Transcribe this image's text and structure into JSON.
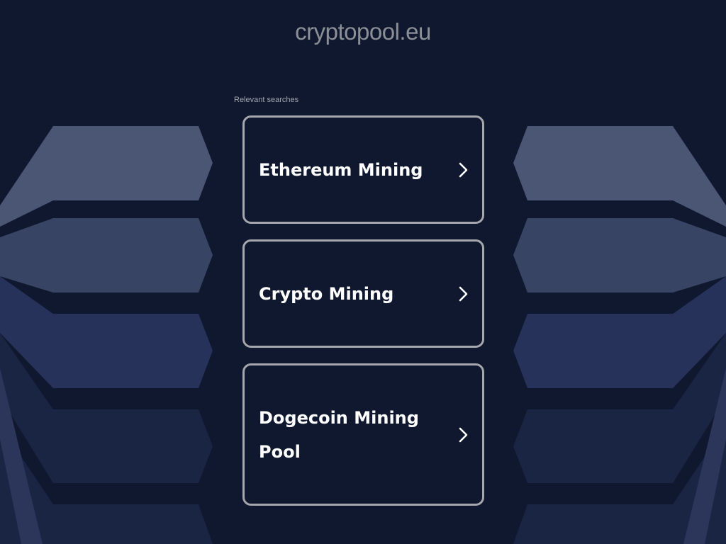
{
  "site": {
    "title": "cryptopool.eu"
  },
  "searches": {
    "heading": "Relevant searches",
    "items": [
      {
        "label": "Ethereum Mining",
        "icon": "chevron-right-icon"
      },
      {
        "label": "Crypto Mining",
        "icon": "chevron-right-icon"
      },
      {
        "label": "Dogecoin Mining Pool",
        "icon": "chevron-right-icon"
      }
    ]
  },
  "colors": {
    "background": "#0f182f",
    "card_border": "#a5a7ac",
    "card_text": "#ffffff",
    "title_text": "#8c8f96",
    "shape_light": "#4b5675",
    "shape_mid": "#384463",
    "shape_dark": "#1e2a4a"
  }
}
